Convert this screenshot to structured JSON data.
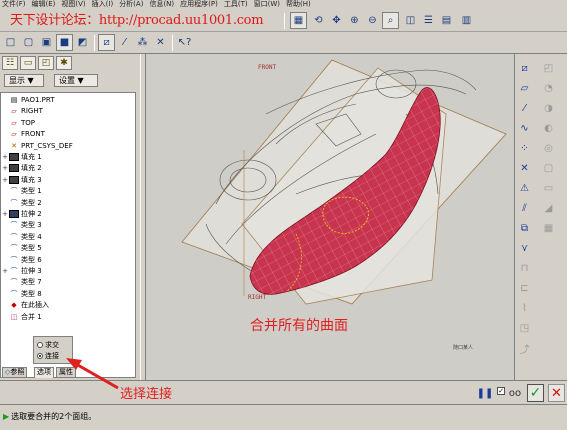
{
  "menu": [
    "文件(F)",
    "编辑(E)",
    "视图(V)",
    "插入(I)",
    "分析(A)",
    "信息(N)",
    "应用程序(P)",
    "工具(T)",
    "窗口(W)",
    "帮助(H)"
  ],
  "watermark": "天下设计论坛：http://procad.uu1001.com",
  "left_panel": {
    "show_label": "显示 ▼",
    "settings_label": "设置 ▼"
  },
  "tree": [
    {
      "exp": "",
      "icon": "part",
      "label": "PAO1.PRT"
    },
    {
      "exp": "",
      "icon": "plane",
      "label": "RIGHT"
    },
    {
      "exp": "",
      "icon": "plane",
      "label": "TOP"
    },
    {
      "exp": "",
      "icon": "plane",
      "label": "FRONT"
    },
    {
      "exp": "",
      "icon": "csys",
      "label": "PRT_CSYS_DEF"
    },
    {
      "exp": "+",
      "icon": "fill",
      "label": "填充 1"
    },
    {
      "exp": "+",
      "icon": "fill",
      "label": "填充 2"
    },
    {
      "exp": "+",
      "icon": "fill",
      "label": "填充 3"
    },
    {
      "exp": "",
      "icon": "type",
      "label": "类型 1"
    },
    {
      "exp": "",
      "icon": "type",
      "label": "类型 2"
    },
    {
      "exp": "+",
      "icon": "ext",
      "label": "拉伸 2"
    },
    {
      "exp": "",
      "icon": "type",
      "label": "类型 3"
    },
    {
      "exp": "",
      "icon": "type",
      "label": "类型 4"
    },
    {
      "exp": "",
      "icon": "type",
      "label": "类型 5"
    },
    {
      "exp": "",
      "icon": "type",
      "label": "类型 6"
    },
    {
      "exp": "+",
      "icon": "type",
      "label": "拉伸 3"
    },
    {
      "exp": "",
      "icon": "type",
      "label": "类型 7"
    },
    {
      "exp": "",
      "icon": "type",
      "label": "类型 8"
    },
    {
      "exp": "",
      "icon": "insert",
      "label": "在此插入"
    },
    {
      "exp": "",
      "icon": "merge",
      "label": "合并 1"
    }
  ],
  "popup": {
    "option_intersect": "求交",
    "option_join": "连接",
    "selected": "连接"
  },
  "tabs": [
    "参照",
    "选项",
    "属性"
  ],
  "viewport": {
    "label_front": "FRONT",
    "label_right": "RIGHT",
    "annotation": "合并所有的曲面",
    "tiny_label": "随口某人"
  },
  "callout": "选择连接",
  "status": "选取要合并的2个面组。",
  "colors": {
    "surface": "#c8344e",
    "annotation": "#e02020",
    "ok": "#1a9a20",
    "cancel": "#d01010"
  }
}
